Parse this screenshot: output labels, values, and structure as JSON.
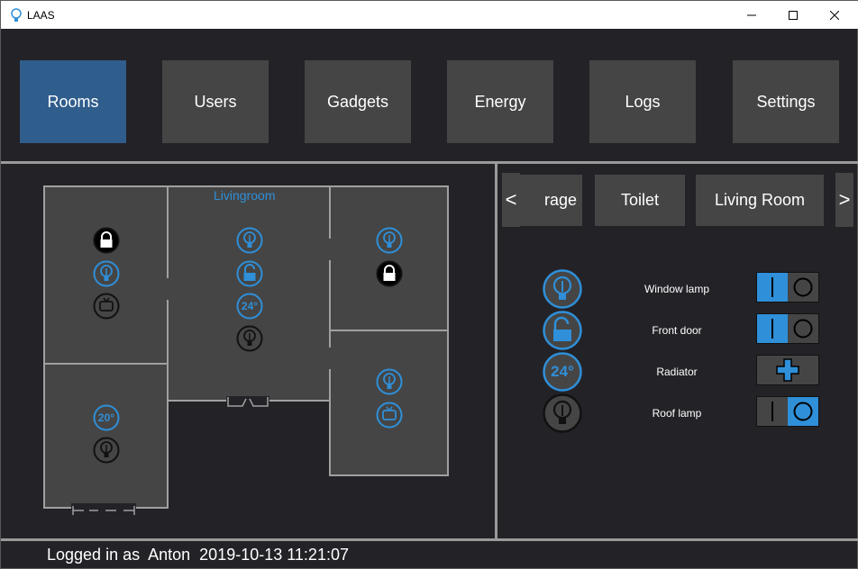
{
  "window": {
    "title": "LAAS",
    "controls": [
      "minimize",
      "maximize",
      "close"
    ]
  },
  "nav": {
    "active": "Rooms",
    "items": [
      "Rooms",
      "Users",
      "Gadgets",
      "Energy",
      "Logs",
      "Settings"
    ]
  },
  "floorplan": {
    "room_label": "Livingroom",
    "temp_left": "20°",
    "temp_center": "24°"
  },
  "room_tabs": {
    "prev": "<",
    "next": ">",
    "items": [
      "rage",
      "Toilet",
      "Living Room"
    ]
  },
  "devices": [
    {
      "name": "Window lamp",
      "icon": "lamp-icon",
      "state": "on",
      "control": "toggle"
    },
    {
      "name": "Front door",
      "icon": "unlock-icon",
      "state": "on",
      "control": "toggle"
    },
    {
      "name": "Radiator",
      "icon": "temperature-icon",
      "label": "24°",
      "control": "plus"
    },
    {
      "name": "Roof lamp",
      "icon": "lamp-icon",
      "state": "off",
      "control": "toggle"
    }
  ],
  "status": {
    "prefix": "Logged in as",
    "user": "Anton",
    "timestamp": "2019-10-13 11:21:07"
  },
  "colors": {
    "accent": "#2f8fd8",
    "active_nav": "#2f5d8c",
    "panel": "#454545",
    "background": "#232227"
  }
}
